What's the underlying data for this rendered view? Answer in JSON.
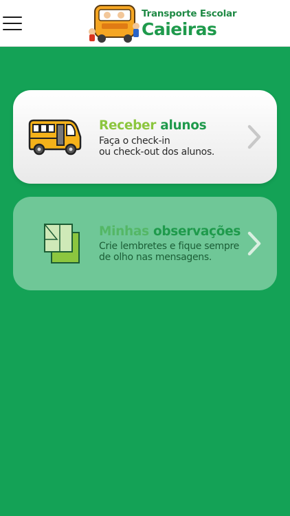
{
  "header": {
    "logo_title": "Transporte Escolar",
    "logo_city": "Caieiras",
    "menu_icon": "hamburger-menu-icon"
  },
  "cards": [
    {
      "title_light": "Receber",
      "title_dark": "alunos",
      "line1": "Faça o check-in",
      "line2": "ou check-out dos alunos.",
      "icon": "school-bus-icon"
    },
    {
      "title_light": "Minhas",
      "title_dark": "observações",
      "line1": "Crie lembretes e fique sempre",
      "line2": "de olho nas mensagens.",
      "icon": "notes-icon"
    }
  ],
  "colors": {
    "background": "#14a256",
    "accent_light": "#8cc63f",
    "accent_dark": "#1f9a4c",
    "bus_yellow": "#f5b21a"
  }
}
